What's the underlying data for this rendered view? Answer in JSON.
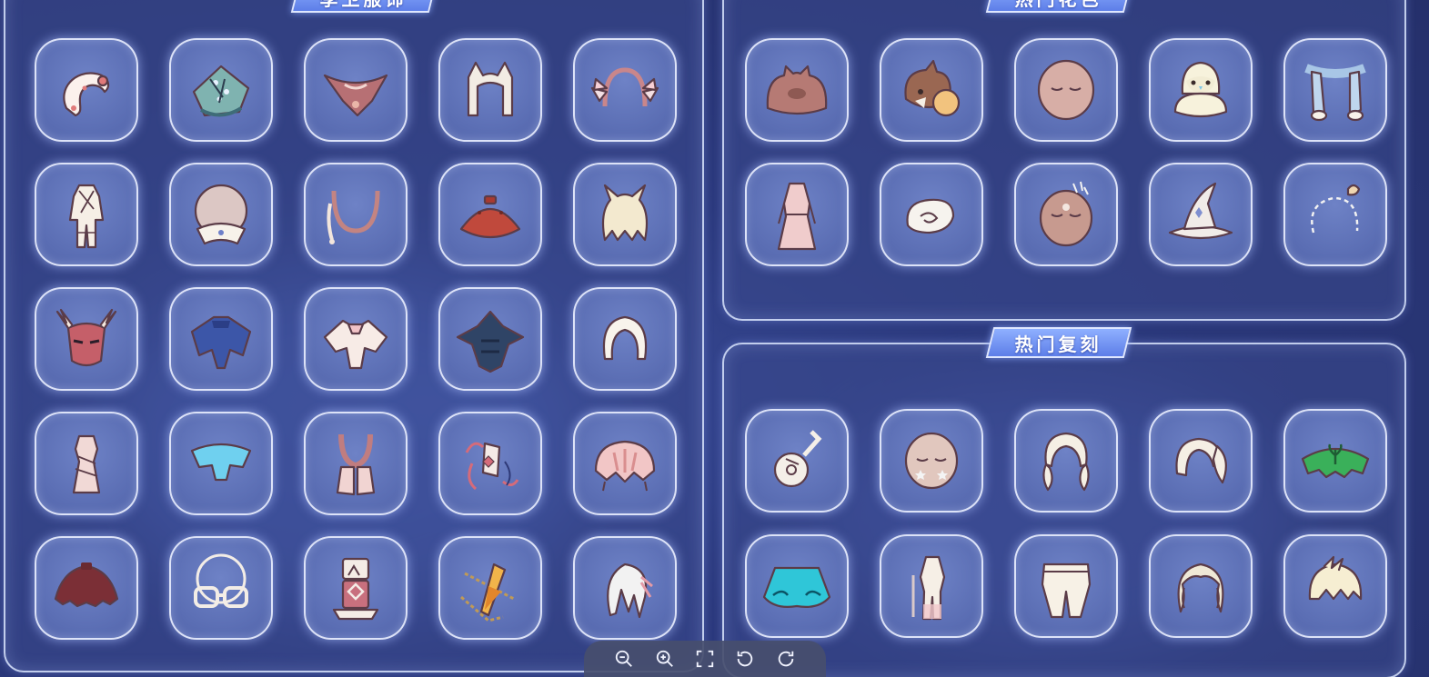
{
  "panels": {
    "left": {
      "title": "季卫服饰"
    },
    "top_right": {
      "title": "热门花色"
    },
    "bottom_right": {
      "title": "热门复刻"
    }
  },
  "left_items": [
    "white-fox-tail-icon",
    "teal-blossom-cape-icon",
    "red-bird-wings-icon",
    "white-cat-ears-hood-icon",
    "pink-wing-headband-icon",
    "white-outfit-icon",
    "round-hood-mask-icon",
    "pink-necklace-icon",
    "red-cape-icon",
    "cream-horned-hair-icon",
    "red-antler-mask-icon",
    "blue-cape-icon",
    "white-butterfly-cape-icon",
    "dark-wing-cape-icon",
    "white-hair-icon",
    "pink-tunic-icon",
    "cyan-cape-icon",
    "pink-scarf-icon",
    "ribbon-accessory-icon",
    "pink-shell-cape-icon",
    "maroon-cape-icon",
    "glasses-icon",
    "totem-prop-icon",
    "gold-sword-icon",
    "long-white-hair-icon"
  ],
  "top_right_items": [
    "brown-frog-hat-icon",
    "bear-bee-plush-icon",
    "pink-round-mask-icon",
    "white-penguin-hat-icon",
    "light-blue-scarf-icon",
    "pink-robe-outfit-icon",
    "white-swirl-hair-icon",
    "moon-face-mask-icon",
    "witch-hat-icon",
    "dashed-shell-hair-icon"
  ],
  "bottom_right_items": [
    "guitar-icon",
    "star-face-mask-icon",
    "twin-braid-hair-icon",
    "side-ponytail-hair-icon",
    "green-leaf-cape-icon",
    "cyan-wave-cape-icon",
    "white-sword-outfit-icon",
    "white-pants-icon",
    "curly-hair-icon",
    "short-white-hair-icon"
  ],
  "toolbar": {
    "zoom_out": "zoom-out-icon",
    "zoom_in": "zoom-in-icon",
    "fullscreen": "fullscreen-icon",
    "rotate_left": "rotate-left-icon",
    "rotate_right": "rotate-right-icon"
  },
  "colors": {
    "background": "#2c3a7e",
    "panel_border": "#dfe7ff",
    "title_bg": "#6f8ff0",
    "tile_bg": "#5a6db3"
  }
}
